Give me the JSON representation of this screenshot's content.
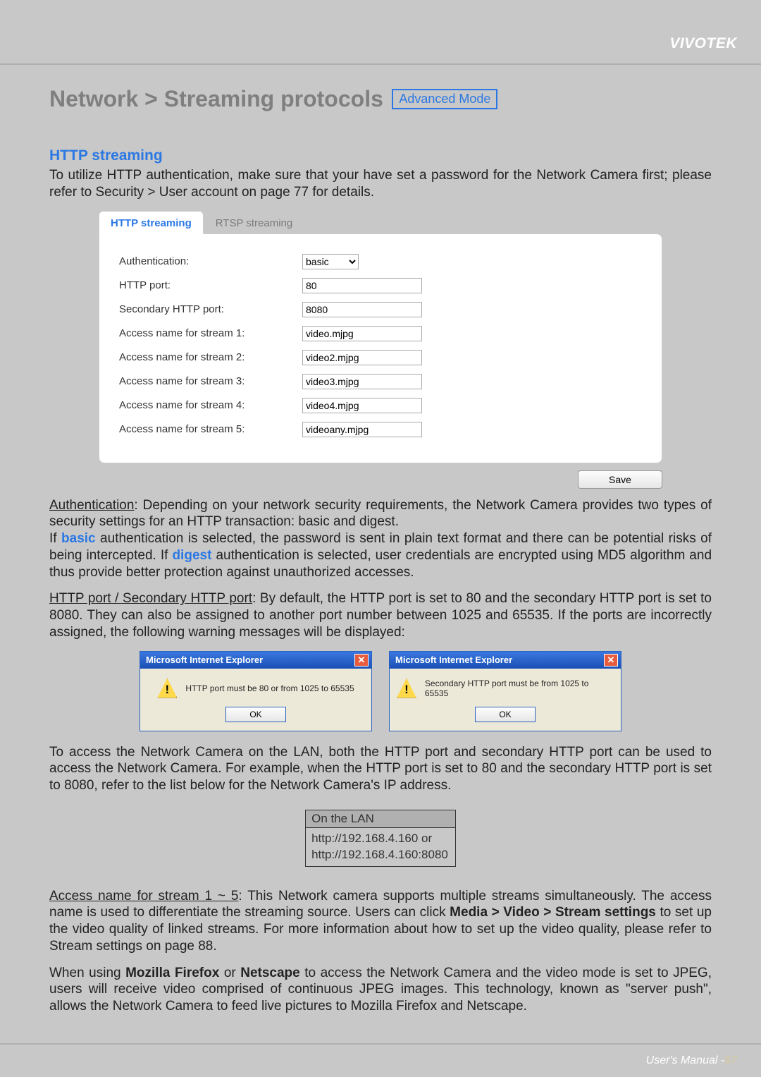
{
  "brand": "VIVOTEK",
  "page_title": "Network > Streaming protocols",
  "mode_badge": "Advanced Mode",
  "section_title": "HTTP streaming",
  "intro_text": "To utilize HTTP authentication, make sure that your have set a password for the Network Camera first; please refer to Security > User account on page 77 for details.",
  "tabs": {
    "http": "HTTP streaming",
    "rtsp": "RTSP streaming"
  },
  "form": {
    "auth_label": "Authentication:",
    "auth_value": "basic",
    "http_port_label": "HTTP port:",
    "http_port_value": "80",
    "sec_http_port_label": "Secondary HTTP port:",
    "sec_http_port_value": "8080",
    "s1_label": "Access name for stream 1:",
    "s1_value": "video.mjpg",
    "s2_label": "Access name for stream 2:",
    "s2_value": "video2.mjpg",
    "s3_label": "Access name for stream 3:",
    "s3_value": "video3.mjpg",
    "s4_label": "Access name for stream 4:",
    "s4_value": "video4.mjpg",
    "s5_label": "Access name for stream 5:",
    "s5_value": "videoany.mjpg",
    "save_button": "Save"
  },
  "para_auth": {
    "lead": "Authentication",
    "rest1": ": Depending on your network security requirements, the Network Camera provides two types of security settings for an HTTP transaction: basic and digest.",
    "rest2a": "If ",
    "basic": "basic",
    "rest2b": " authentication is selected, the password is sent in plain text format and there can be potential risks of being intercepted. If ",
    "digest": "digest",
    "rest2c": " authentication is selected, user credentials are encrypted using MD5 algorithm and thus provide better protection against unauthorized accesses."
  },
  "para_port": {
    "lead": "HTTP port / Secondary HTTP port",
    "rest": ": By default, the HTTP port is set to 80 and the secondary HTTP port is set to 8080. They can also be assigned to another port number between 1025 and 65535. If the ports are incorrectly assigned, the following warning messages will be displayed:"
  },
  "dialog1": {
    "title": "Microsoft Internet Explorer",
    "msg": "HTTP port must be 80 or from 1025 to 65535",
    "ok": "OK"
  },
  "dialog2": {
    "title": "Microsoft Internet Explorer",
    "msg": "Secondary HTTP port must be from 1025 to 65535",
    "ok": "OK"
  },
  "para_lan": "To access the Network Camera on the LAN, both the HTTP port and secondary HTTP port can be used to access the Network Camera. For example, when the HTTP port is set to 80 and the secondary HTTP port is set to 8080, refer to the list below for the Network Camera's IP address.",
  "lan_table": {
    "header": "On the LAN",
    "row1": "http://192.168.4.160  or",
    "row2": "http://192.168.4.160:8080"
  },
  "para_access": {
    "lead": "Access name for stream 1 ~ 5",
    "rest1": ": This Network camera supports multiple streams simultaneously. The access name is used to differentiate the streaming source. Users can click ",
    "bold1": "Media > Video > Stream settings",
    "rest2": " to set up the video quality of linked streams. For more information about how to set up the video quality, please refer to Stream settings on page 88."
  },
  "para_firefox": {
    "a": "When using ",
    "b1": "Mozilla Firefox",
    "c": " or ",
    "b2": "Netscape",
    "d": " to access the Network Camera and the video mode is set to JPEG, users will receive video comprised of continuous JPEG images. This technology, known as \"server push\", allows the Network Camera to feed live pictures to Mozilla Firefox and Netscape."
  },
  "footer": {
    "manual": "User's Manual - ",
    "page": "67"
  }
}
